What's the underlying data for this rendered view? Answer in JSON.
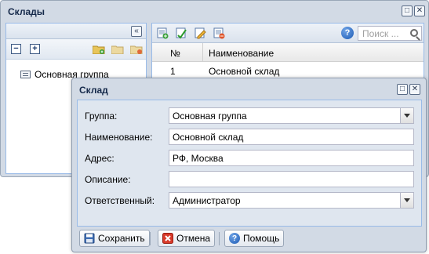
{
  "outer_window": {
    "title": "Склады",
    "maximize_glyph": "□",
    "close_glyph": "✕"
  },
  "tree_panel": {
    "collapse_glyph": "«",
    "collapse_all_glyph": "−",
    "expand_all_glyph": "+",
    "node_label": "Основная группа",
    "icons": [
      "folder-add-icon",
      "folder-edit-icon",
      "folder-delete-icon"
    ]
  },
  "grid_panel": {
    "toolbar_icons": [
      "add-record-icon",
      "edit-record-icon",
      "edit-pencil-icon",
      "delete-record-icon"
    ],
    "help_glyph": "?",
    "search_placeholder": "Поиск ...",
    "columns": [
      "№",
      "Наименование"
    ],
    "rows": [
      {
        "num": "1",
        "name": "Основной склад"
      }
    ]
  },
  "dialog": {
    "title": "Склад",
    "maximize_glyph": "□",
    "close_glyph": "✕",
    "fields": {
      "group": {
        "label": "Группа:",
        "value": "Основная группа"
      },
      "name": {
        "label": "Наименование:",
        "value": "Основной склад"
      },
      "address": {
        "label": "Адрес:",
        "value": "РФ, Москва"
      },
      "description": {
        "label": "Описание:",
        "value": ""
      },
      "responsible": {
        "label": "Ответственный:",
        "value": "Администратор"
      }
    },
    "buttons": {
      "save": "Сохранить",
      "cancel": "Отмена",
      "help": "Помощь"
    }
  },
  "colors": {
    "window_bg": "#d2dae5",
    "panel_border": "#99bbe8",
    "title_text": "#15294a"
  }
}
